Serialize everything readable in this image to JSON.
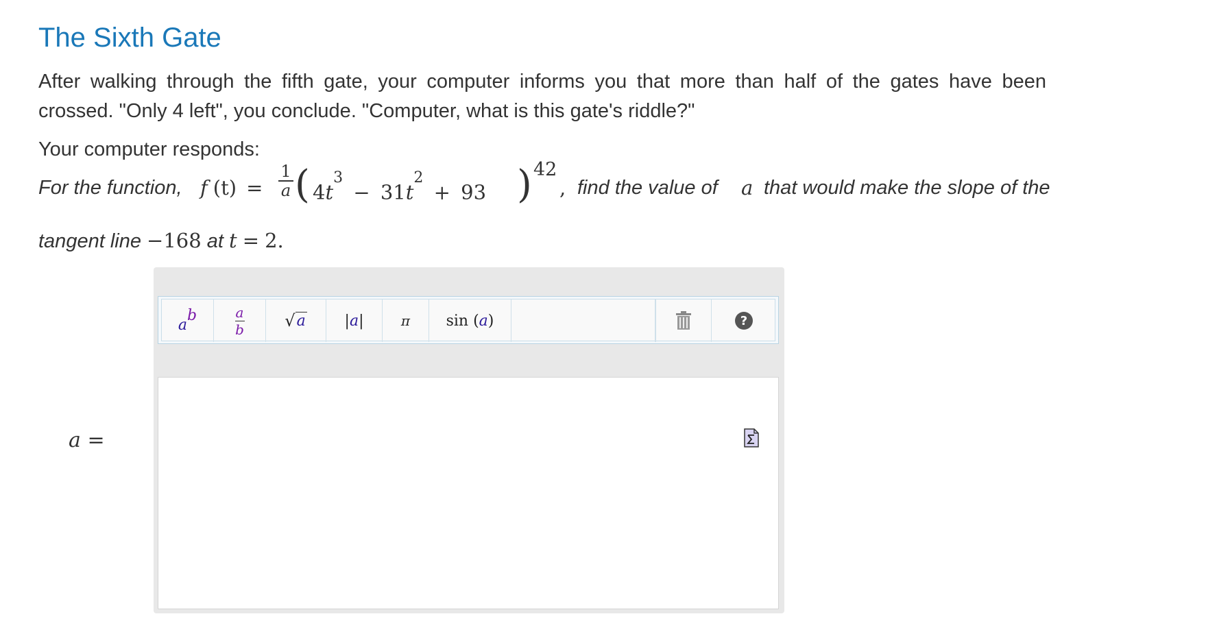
{
  "title": "The Sixth Gate",
  "intro": "After walking through the fifth gate, your computer informs you that more than half of the gates have been crossed. \"Only 4 left\", you conclude. \"Computer, what is this gate's riddle?\"",
  "responds": "Your computer responds:",
  "problem": {
    "lead": "For the function,",
    "func_name": "f",
    "func_arg": "(t)",
    "equals": "=",
    "frac_num": "1",
    "frac_den": "a",
    "term1_coef": "4",
    "term1_var": "t",
    "term1_exp": "3",
    "minus": "−",
    "term2_coef": "31",
    "term2_var": "t",
    "term2_exp": "2",
    "plus": "+",
    "term3": "93",
    "outer_exp": "42",
    "comma": ",",
    "mid": "find the value of",
    "var_a": "a",
    "tail": "that would make the slope of the",
    "line2_lead": "tangent line",
    "slope_value": "−168",
    "at": "at",
    "t_var": "t",
    "t_eq": "=",
    "t_value": "2."
  },
  "answer": {
    "label_var": "a",
    "label_eq": "=",
    "value": ""
  },
  "toolbar": {
    "power_base": "a",
    "power_exp": "b",
    "frac_num": "a",
    "frac_den": "b",
    "sqrt_label": "√",
    "sqrt_var": "a",
    "abs_label": "|a|",
    "abs_open": "|",
    "abs_var": "a",
    "abs_close": "|",
    "pi_label": "π",
    "sin_label": "sin",
    "sin_var": "a",
    "trash_icon": "trash-icon",
    "help_icon": "help-icon",
    "help_glyph": "?"
  },
  "colors": {
    "title": "#1a78b8",
    "text": "#333333",
    "widget_bg": "#e8e8e8",
    "toolbar_border": "#b7d3e3"
  }
}
